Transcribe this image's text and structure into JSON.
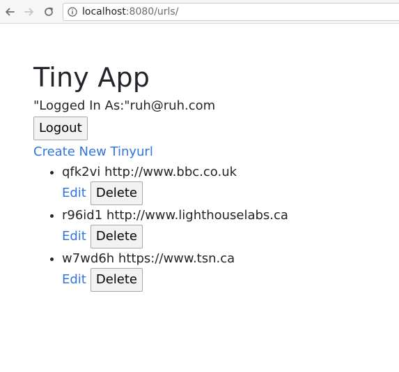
{
  "browser": {
    "url_host": "localhost",
    "url_rest": ":8080/urls/"
  },
  "page": {
    "title": "Tiny App",
    "logged_in_text": "\"Logged In As:\"ruh@ruh.com",
    "logout_label": "Logout",
    "create_link_label": "Create New Tinyurl"
  },
  "urls": [
    {
      "short": "qfk2vi",
      "long": "http://www.bbc.co.uk",
      "edit_label": "Edit",
      "delete_label": "Delete"
    },
    {
      "short": "r96id1",
      "long": "http://www.lighthouselabs.ca",
      "edit_label": "Edit",
      "delete_label": "Delete"
    },
    {
      "short": "w7wd6h",
      "long": "https://www.tsn.ca",
      "edit_label": "Edit",
      "delete_label": "Delete"
    }
  ],
  "icons": {
    "back": "back-arrow-icon",
    "forward": "forward-arrow-icon",
    "reload": "reload-icon",
    "info": "info-icon"
  },
  "colors": {
    "link": "#2f74e0",
    "text": "#212529",
    "button_bg": "#f2f2f2"
  }
}
